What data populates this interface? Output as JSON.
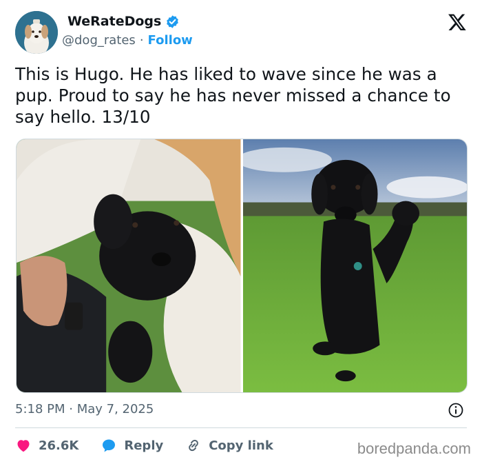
{
  "author": {
    "display_name": "WeRateDogs",
    "handle": "@dog_rates",
    "separator": "·",
    "follow_label": "Follow",
    "verified": true
  },
  "tweet": {
    "text": "This is Hugo. He has liked to wave since he was a pup. Proud to say he has never missed a chance to say hello. 13/10",
    "timestamp": "5:18 PM · May 7, 2025"
  },
  "media": [
    {
      "description": "black puppy held in arms waving paw"
    },
    {
      "description": "black dog sitting on grass waving paw"
    }
  ],
  "actions": {
    "like_count": "26.6K",
    "reply_label": "Reply",
    "copy_label": "Copy link"
  },
  "watermark": "boredpanda.com",
  "colors": {
    "accent": "#1d9bf0",
    "like": "#f91880",
    "text": "#0f1419",
    "muted": "#536471"
  }
}
